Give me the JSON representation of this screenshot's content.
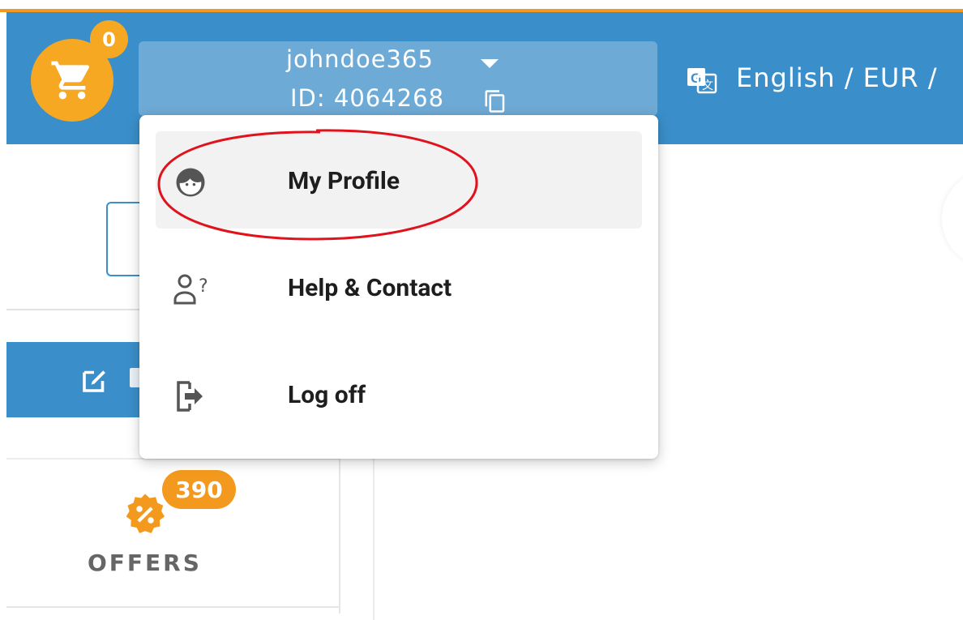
{
  "header": {
    "cart_count": "0",
    "username": "johndoe365",
    "user_id": "ID: 4064268",
    "language_currency": "English / EUR /"
  },
  "user_menu": {
    "items": [
      {
        "label": "My Profile",
        "icon": "profile-face-icon",
        "highlighted": true
      },
      {
        "label": "Help & Contact",
        "icon": "person-question-icon"
      },
      {
        "label": "Log off",
        "icon": "logout-icon"
      }
    ]
  },
  "sidebar": {
    "offers_label": "OFFERS",
    "offers_count": "390"
  },
  "colors": {
    "header_blue": "#3a8fca",
    "user_box": "#6eaad6",
    "accent_orange": "#f7a823",
    "highlight_red": "#e0121c"
  }
}
